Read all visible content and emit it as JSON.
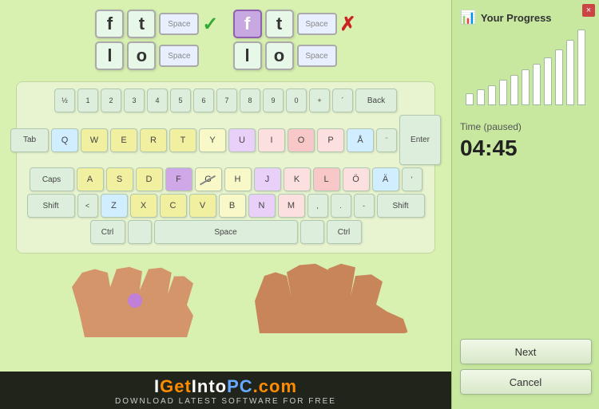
{
  "window": {
    "close_label": "×"
  },
  "word_display": {
    "group1": {
      "row1": {
        "letter1": "f",
        "letter2": "t",
        "space": "Space",
        "status": "✓"
      },
      "row2": {
        "letter1": "l",
        "letter2": "o",
        "space": "Space"
      }
    },
    "group2": {
      "row1": {
        "letter1": "f",
        "letter2": "t",
        "space": "Space",
        "status": "✗"
      },
      "row2": {
        "letter1": "l",
        "letter2": "o",
        "space": "Space"
      }
    }
  },
  "keyboard": {
    "rows": [
      [
        "½",
        "1",
        "2",
        "3",
        "4",
        "5",
        "6",
        "7",
        "8",
        "9",
        "0",
        "+",
        "´",
        "Back"
      ],
      [
        "Tab",
        "Q",
        "W",
        "E",
        "R",
        "T",
        "Y",
        "U",
        "I",
        "O",
        "P",
        "Å",
        "¨",
        "Enter"
      ],
      [
        "Caps",
        "A",
        "S",
        "D",
        "F",
        "G",
        "H",
        "J",
        "K",
        "L",
        "Ö",
        "Ä",
        "'"
      ],
      [
        "Shift",
        "<",
        "Z",
        "X",
        "C",
        "V",
        "B",
        "N",
        "M",
        ",",
        ".",
        "-",
        "Shift"
      ],
      [
        "Ctrl",
        "",
        "Space",
        "",
        "Ctrl"
      ]
    ]
  },
  "progress": {
    "title": "Your Progress",
    "bars": [
      15,
      20,
      25,
      32,
      38,
      45,
      52,
      60,
      70,
      82,
      95
    ],
    "time_label": "Time (paused)",
    "time_value": "04:45"
  },
  "buttons": {
    "next": "Next",
    "cancel": "Cancel"
  },
  "watermark": {
    "line1_white1": "I",
    "line1_orange": "Get",
    "line1_white2": "Into",
    "line1_blue": "PC",
    "line1_orange2": ".com",
    "line2": "Download Latest Software for Free"
  }
}
